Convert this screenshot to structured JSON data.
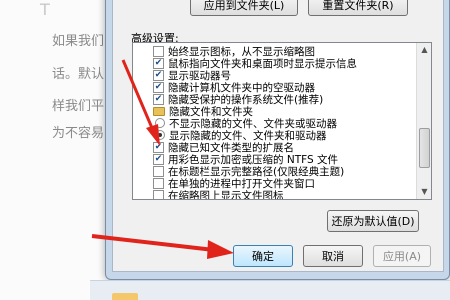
{
  "background": {
    "lines": [
      "如果我们",
      "话。默认",
      "样我们平",
      "为不容易"
    ],
    "heading_fragment": "T"
  },
  "top_buttons": {
    "apply_to_folders": "应用到文件夹(L)",
    "reset_folders": "重置文件夹(R)"
  },
  "advanced": {
    "label": "高级设置:",
    "items": [
      {
        "type": "checkbox",
        "checked": false,
        "label": "始终显示图标，从不显示缩略图"
      },
      {
        "type": "checkbox",
        "checked": true,
        "label": "鼠标指向文件夹和桌面项时显示提示信息"
      },
      {
        "type": "checkbox",
        "checked": true,
        "label": "显示驱动器号"
      },
      {
        "type": "checkbox",
        "checked": true,
        "label": "隐藏计算机文件夹中的空驱动器"
      },
      {
        "type": "checkbox",
        "checked": true,
        "label": "隐藏受保护的操作系统文件(推荐)"
      },
      {
        "type": "folder",
        "label": "隐藏文件和文件夹"
      },
      {
        "type": "radio",
        "checked": false,
        "label": "不显示隐藏的文件、文件夹或驱动器"
      },
      {
        "type": "radio",
        "checked": true,
        "label": "显示隐藏的文件、文件夹和驱动器"
      },
      {
        "type": "checkbox",
        "checked": true,
        "label": "隐藏已知文件类型的扩展名"
      },
      {
        "type": "checkbox",
        "checked": true,
        "label": "用彩色显示加密或压缩的 NTFS 文件"
      },
      {
        "type": "checkbox",
        "checked": false,
        "label": "在标题栏显示完整路径(仅限经典主题)"
      },
      {
        "type": "checkbox",
        "checked": false,
        "label": "在单独的进程中打开文件夹窗口"
      },
      {
        "type": "checkbox",
        "checked": false,
        "label": "在缩略图上显示文件图标"
      }
    ]
  },
  "restore_defaults": "还原为默认值(D)",
  "bottom_buttons": {
    "ok": "确定",
    "cancel": "取消",
    "apply": "应用(A)"
  },
  "colors": {
    "arrow": "#e0241c",
    "frame": "#c7d7ea",
    "panel": "#f0f0f0"
  },
  "icons": [
    "folder-icon",
    "checkmark-icon",
    "radio-dot-icon",
    "scroll-up-icon",
    "scroll-down-icon"
  ]
}
